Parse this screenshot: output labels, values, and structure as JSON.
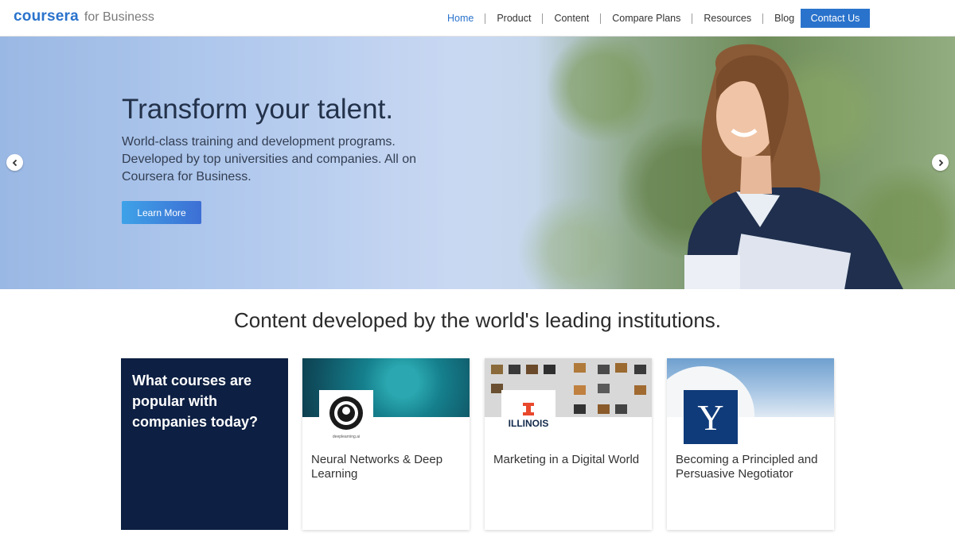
{
  "header": {
    "logo_word": "coursera",
    "logo_sub": "for Business",
    "nav": [
      "Home",
      "Product",
      "Content",
      "Compare Plans",
      "Resources",
      "Blog"
    ],
    "active": "Home",
    "contact_label": "Contact Us"
  },
  "hero": {
    "title": "Transform your talent.",
    "text": "World-class training and development programs. Developed by top universities and companies. All on Coursera for Business.",
    "button_label": "Learn More"
  },
  "section": {
    "title": "Content developed by the world's leading institutions.",
    "promo_text": "What courses are popular with companies today?",
    "cards": [
      {
        "title": "Neural Networks & Deep Learning",
        "logo_caption": "deeplearning.ai"
      },
      {
        "title": "Marketing in a Digital World",
        "logo_caption": "ILLINOIS"
      },
      {
        "title": "Becoming a Principled and Persuasive Negotiator",
        "logo_caption": "Y"
      }
    ]
  },
  "colors": {
    "brand": "#2a73cc",
    "promo_bg": "#0d1f42",
    "yale": "#0f3b7a",
    "illinois": "#e8482c"
  },
  "icons": [
    "chevron-left-icon",
    "chevron-right-icon",
    "deeplearning-logo",
    "illinois-logo",
    "yale-logo"
  ]
}
